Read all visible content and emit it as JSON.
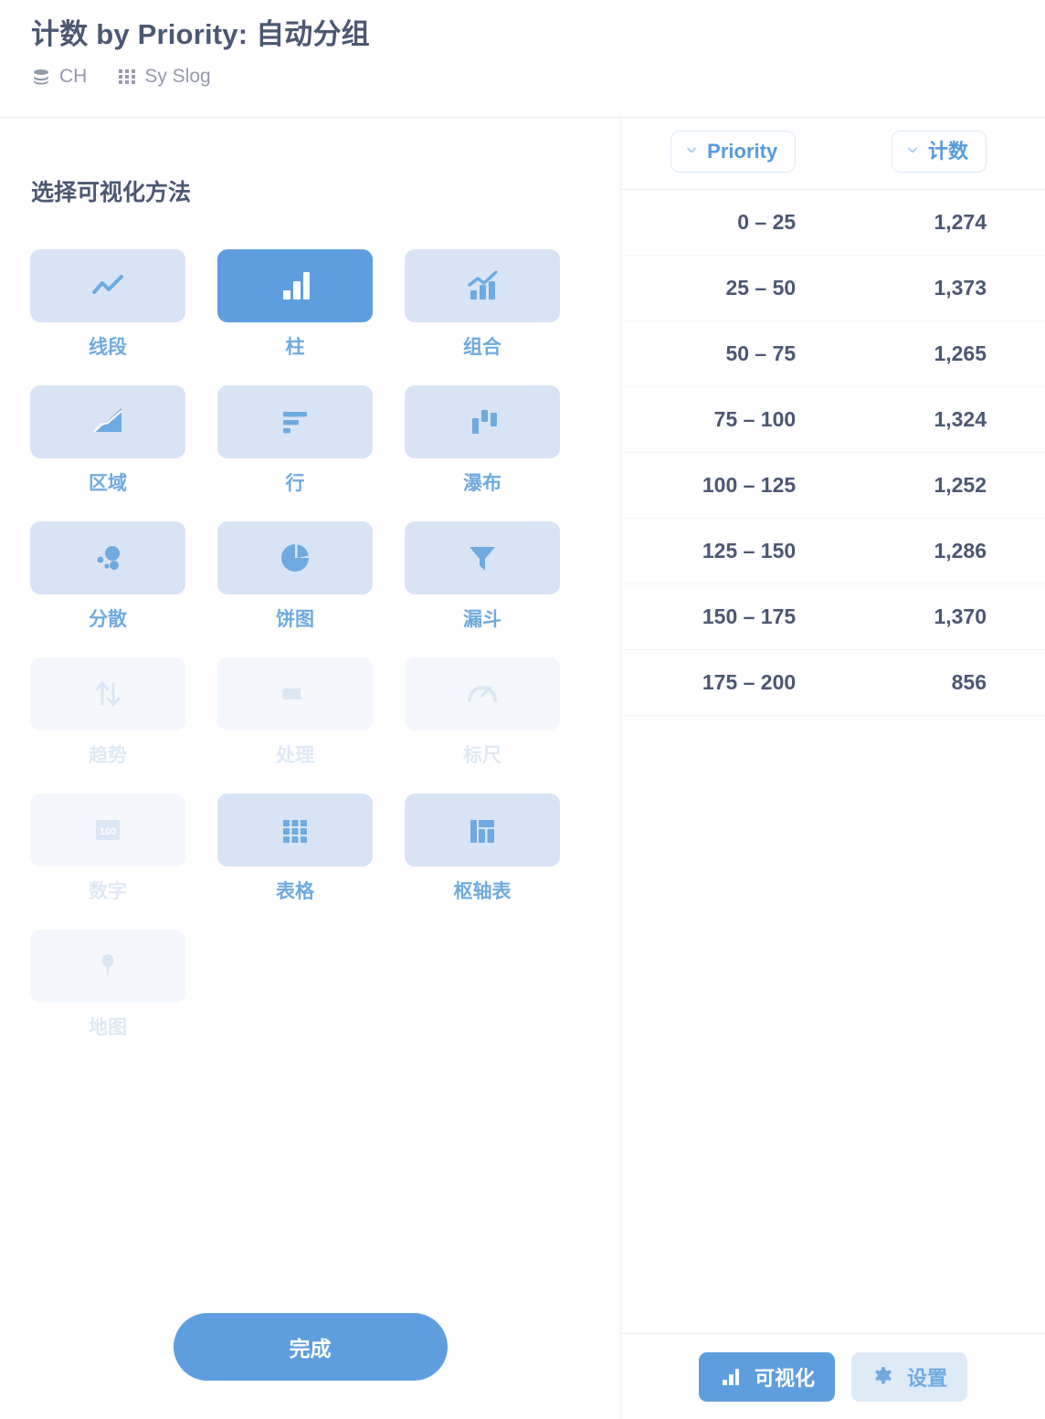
{
  "header": {
    "title": "计数 by Priority: 自动分组",
    "source_items": [
      {
        "icon": "database-icon",
        "label": "CH"
      },
      {
        "icon": "grid-dots-icon",
        "label": "Sy Slog"
      }
    ]
  },
  "left_panel": {
    "section_title": "选择可视化方法",
    "done_label": "完成",
    "visualizations": [
      {
        "id": "line",
        "label": "线段",
        "icon": "line-chart-icon",
        "state": "enabled"
      },
      {
        "id": "bar",
        "label": "柱",
        "icon": "bar-chart-icon",
        "state": "selected"
      },
      {
        "id": "combo",
        "label": "组合",
        "icon": "combo-chart-icon",
        "state": "enabled"
      },
      {
        "id": "area",
        "label": "区域",
        "icon": "area-chart-icon",
        "state": "enabled"
      },
      {
        "id": "row",
        "label": "行",
        "icon": "row-chart-icon",
        "state": "enabled"
      },
      {
        "id": "waterfall",
        "label": "瀑布",
        "icon": "waterfall-icon",
        "state": "enabled"
      },
      {
        "id": "scatter",
        "label": "分散",
        "icon": "scatter-icon",
        "state": "enabled"
      },
      {
        "id": "pie",
        "label": "饼图",
        "icon": "pie-chart-icon",
        "state": "enabled"
      },
      {
        "id": "funnel",
        "label": "漏斗",
        "icon": "funnel-icon",
        "state": "enabled"
      },
      {
        "id": "trend",
        "label": "趋势",
        "icon": "trend-arrows-icon",
        "state": "disabled"
      },
      {
        "id": "progress",
        "label": "处理",
        "icon": "progress-bar-icon",
        "state": "disabled"
      },
      {
        "id": "gauge",
        "label": "标尺",
        "icon": "gauge-icon",
        "state": "disabled"
      },
      {
        "id": "number",
        "label": "数字",
        "icon": "number-icon",
        "state": "disabled",
        "icon_text": "100"
      },
      {
        "id": "table",
        "label": "表格",
        "icon": "table-grid-icon",
        "state": "enabled"
      },
      {
        "id": "pivot",
        "label": "枢轴表",
        "icon": "pivot-table-icon",
        "state": "enabled"
      },
      {
        "id": "map",
        "label": "地图",
        "icon": "map-pin-icon",
        "state": "disabled"
      }
    ]
  },
  "right_panel": {
    "columns": [
      {
        "key": "priority",
        "label": "Priority",
        "icon": "chevron-down-icon"
      },
      {
        "key": "count",
        "label": "计数",
        "icon": "chevron-down-icon"
      }
    ],
    "footer_buttons": [
      {
        "id": "visualization",
        "label": "可视化",
        "icon": "bar-chart-icon",
        "state": "active"
      },
      {
        "id": "settings",
        "label": "设置",
        "icon": "gear-icon",
        "state": "inactive"
      }
    ]
  },
  "chart_data": {
    "type": "table",
    "title": "计数 by Priority: 自动分组",
    "columns": [
      "Priority",
      "计数"
    ],
    "categories": [
      "0 – 25",
      "25 – 50",
      "50 – 75",
      "75 – 100",
      "100 – 125",
      "125 – 150",
      "150 – 175",
      "175 – 200"
    ],
    "values": [
      1274,
      1373,
      1265,
      1324,
      1252,
      1286,
      1370,
      856
    ],
    "rows": [
      {
        "priority": "0 – 25",
        "count": "1,274"
      },
      {
        "priority": "25 – 50",
        "count": "1,373"
      },
      {
        "priority": "50 – 75",
        "count": "1,265"
      },
      {
        "priority": "75 – 100",
        "count": "1,324"
      },
      {
        "priority": "100 – 125",
        "count": "1,252"
      },
      {
        "priority": "125 – 150",
        "count": "1,286"
      },
      {
        "priority": "150 – 175",
        "count": "1,370"
      },
      {
        "priority": "175 – 200",
        "count": "856"
      }
    ],
    "xlabel": "Priority",
    "ylabel": "计数"
  },
  "colors": {
    "accent": "#5f9ede",
    "tile_light": "#d8e4f5",
    "tile_disabled": "#f4f8fc",
    "label_blue": "#6faae0",
    "text_dark": "#4c5773",
    "text_muted": "#949aab"
  }
}
